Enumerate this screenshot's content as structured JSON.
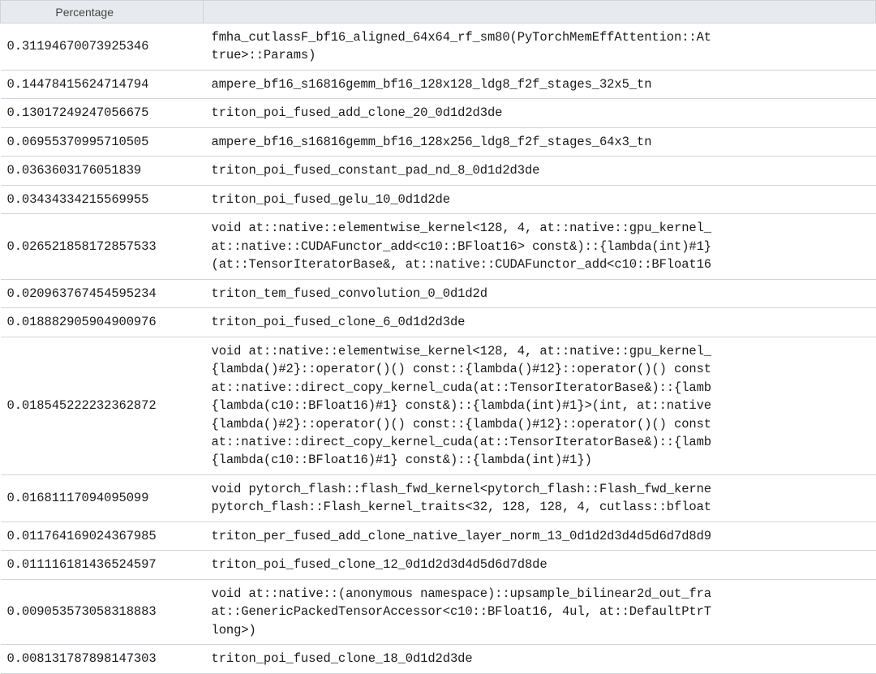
{
  "columns": {
    "percentage_header": "Percentage",
    "name_header": ""
  },
  "rows": [
    {
      "percentage": "0.31194670073925346",
      "name": "fmha_cutlassF_bf16_aligned_64x64_rf_sm80(PyTorchMemEffAttention::At\ntrue>::Params)"
    },
    {
      "percentage": "0.14478415624714794",
      "name": "ampere_bf16_s16816gemm_bf16_128x128_ldg8_f2f_stages_32x5_tn"
    },
    {
      "percentage": "0.13017249247056675",
      "name": "triton_poi_fused_add_clone_20_0d1d2d3de"
    },
    {
      "percentage": "0.06955370995710505",
      "name": "ampere_bf16_s16816gemm_bf16_128x256_ldg8_f2f_stages_64x3_tn"
    },
    {
      "percentage": "0.0363603176051839",
      "name": "triton_poi_fused_constant_pad_nd_8_0d1d2d3de"
    },
    {
      "percentage": "0.03434334215569955",
      "name": "triton_poi_fused_gelu_10_0d1d2de"
    },
    {
      "percentage": "0.026521858172857533",
      "name": "void at::native::elementwise_kernel<128, 4, at::native::gpu_kernel_\nat::native::CUDAFunctor_add<c10::BFloat16> const&)::{lambda(int)#1}\n(at::TensorIteratorBase&, at::native::CUDAFunctor_add<c10::BFloat16"
    },
    {
      "percentage": "0.020963767454595234",
      "name": "triton_tem_fused_convolution_0_0d1d2d"
    },
    {
      "percentage": "0.018882905904900976",
      "name": "triton_poi_fused_clone_6_0d1d2d3de"
    },
    {
      "percentage": "0.018545222232362872",
      "name": "void at::native::elementwise_kernel<128, 4, at::native::gpu_kernel_\n{lambda()#2}::operator()() const::{lambda()#12}::operator()() const\nat::native::direct_copy_kernel_cuda(at::TensorIteratorBase&)::{lamb\n{lambda(c10::BFloat16)#1} const&)::{lambda(int)#1}>(int, at::native\n{lambda()#2}::operator()() const::{lambda()#12}::operator()() const\nat::native::direct_copy_kernel_cuda(at::TensorIteratorBase&)::{lamb\n{lambda(c10::BFloat16)#1} const&)::{lambda(int)#1})"
    },
    {
      "percentage": "0.01681117094095099",
      "name": "void pytorch_flash::flash_fwd_kernel<pytorch_flash::Flash_fwd_kerne\npytorch_flash::Flash_kernel_traits<32, 128, 128, 4, cutlass::bfloat"
    },
    {
      "percentage": "0.011764169024367985",
      "name": "triton_per_fused_add_clone_native_layer_norm_13_0d1d2d3d4d5d6d7d8d9"
    },
    {
      "percentage": "0.011116181436524597",
      "name": "triton_poi_fused_clone_12_0d1d2d3d4d5d6d7d8de"
    },
    {
      "percentage": "0.009053573058318883",
      "name": "void at::native::(anonymous namespace)::upsample_bilinear2d_out_fra\nat::GenericPackedTensorAccessor<c10::BFloat16, 4ul, at::DefaultPtrT\nlong>)"
    },
    {
      "percentage": "0.008131787898147303",
      "name": "triton_poi_fused_clone_18_0d1d2d3de"
    }
  ]
}
